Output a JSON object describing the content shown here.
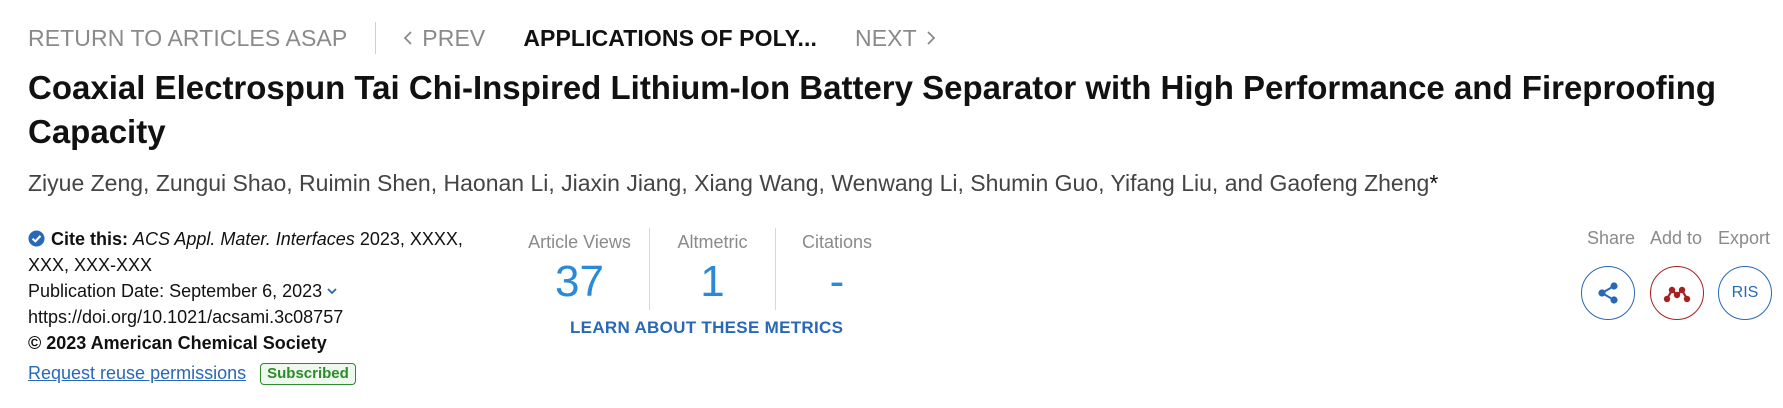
{
  "nav": {
    "return_label": "RETURN TO ARTICLES ASAP",
    "prev_label": "PREV",
    "current_label": "APPLICATIONS OF POLY...",
    "next_label": "NEXT"
  },
  "article": {
    "title": "Coaxial Electrospun Tai Chi-Inspired Lithium-Ion Battery Separator with High Performance and Fireproofing Capacity",
    "authors": "Ziyue Zeng, Zungui Shao, Ruimin Shen, Haonan Li, Jiaxin Jiang, Xiang Wang, Wenwang Li, Shumin Guo, Yifang Liu, and Gaofeng Zheng",
    "corresponding_mark": "*"
  },
  "cite": {
    "label": "Cite this:",
    "journal": "ACS Appl. Mater. Interfaces",
    "details": "2023, XXXX, XXX, XXX-XXX",
    "publication_date": "Publication Date: September 6, 2023",
    "doi": "https://doi.org/10.1021/acsami.3c08757",
    "copyright": "© 2023 American Chemical Society",
    "reuse_link": "Request reuse permissions",
    "badge": "Subscribed"
  },
  "metrics": {
    "views_label": "Article Views",
    "views_value": "37",
    "altmetric_label": "Altmetric",
    "altmetric_value": "1",
    "citations_label": "Citations",
    "citations_value": "-",
    "learn_more": "LEARN ABOUT THESE METRICS"
  },
  "tools": {
    "share_label": "Share",
    "add_label": "Add to",
    "export_label": "Export",
    "export_button": "RIS",
    "share_icon": "share-icon",
    "add_icon": "mendeley-icon"
  },
  "colors": {
    "link": "#2868b6",
    "metric_value": "#2b8ad6",
    "muted": "#8a8a8a",
    "badge_green": "#2d8a2d",
    "add_red": "#a92020"
  }
}
